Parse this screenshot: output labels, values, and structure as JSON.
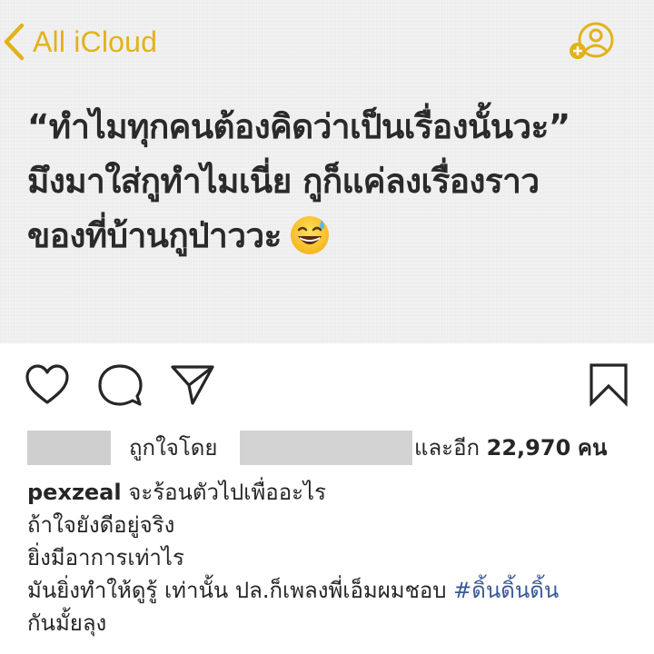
{
  "notes": {
    "back_label": "All iCloud",
    "accent_color": "#e2b21b",
    "share_icon": "add-person-icon",
    "body_lines": [
      "“ทำไมทุกคนต้องคิดว่าเป็นเรื่องนั้นวะ”",
      "มึงมาใส่กูทำไมเนี่ย กูก็แค่ลงเรื่องราว",
      "ของที่บ้านกูป่าววะ"
    ],
    "emoji": "grinning-sweat-emoji"
  },
  "post": {
    "actions": {
      "like_icon": "heart-icon",
      "comment_icon": "comment-icon",
      "share_icon": "send-icon",
      "save_icon": "bookmark-icon"
    },
    "likes": {
      "liked_by_label": "ถูกใจโดย",
      "and_label": "และอีก",
      "count": "22,970",
      "unit": "คน"
    },
    "caption": {
      "username": "pexzeal",
      "first_line": "จะร้อนตัวไปเพื่ออะไร",
      "lines": [
        "ถ้าใจยังดีอยู่จริง",
        "ยิ่งมีอาการเท่าไร"
      ],
      "last_line_text": "มันยิ่งทำให้ดูรู้ เท่านั้น ปล.ก็เพลงพี่เอ็มผมชอบ",
      "hashtag": "#ดิ้นดิ้นดิ้น",
      "continuation": "กันมั้ยลุง"
    },
    "hashtag_color": "#385898"
  }
}
